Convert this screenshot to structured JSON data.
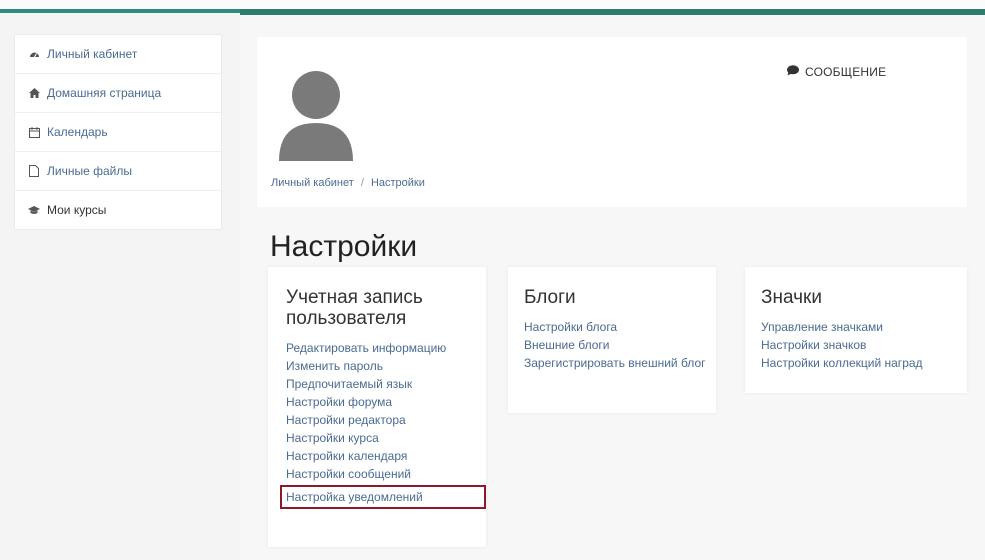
{
  "sidebar": {
    "items": [
      {
        "label": "Личный кабинет",
        "icon": "dashboard-icon"
      },
      {
        "label": "Домашняя страница",
        "icon": "home-icon"
      },
      {
        "label": "Календарь",
        "icon": "calendar-icon"
      },
      {
        "label": "Личные файлы",
        "icon": "file-icon"
      },
      {
        "label": "Мои курсы",
        "icon": "graduation-cap-icon"
      }
    ]
  },
  "profile": {
    "message_button": "СООБЩЕНИЕ"
  },
  "breadcrumb": {
    "home": "Личный кабинет",
    "separator": "/",
    "current": "Настройки"
  },
  "page_title": "Настройки",
  "cards": {
    "account": {
      "title": "Учетная запись пользователя",
      "links": [
        "Редактировать информацию",
        "Изменить пароль",
        "Предпочитаемый язык",
        "Настройки форума",
        "Настройки редактора",
        "Настройки курса",
        "Настройки календаря",
        "Настройки сообщений",
        "Настройка уведомлений"
      ]
    },
    "blogs": {
      "title": "Блоги",
      "links": [
        "Настройки блога",
        "Внешние блоги",
        "Зарегистрировать внешний блог"
      ]
    },
    "badges": {
      "title": "Значки",
      "links": [
        "Управление значками",
        "Настройки значков",
        "Настройки коллекций наград"
      ]
    }
  },
  "colors": {
    "accent": "#2e8a7a",
    "link": "#4a6b92",
    "highlight_border": "#8b1a2b"
  }
}
